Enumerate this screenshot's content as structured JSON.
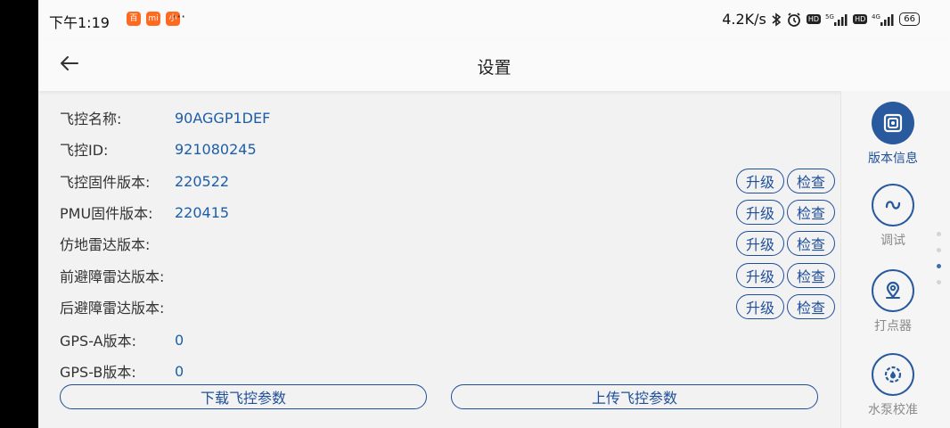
{
  "statusbar": {
    "time": "下午1:19",
    "app_icons": [
      "百",
      "mi",
      "小"
    ],
    "more": "···",
    "speed": "4.2K/s",
    "right_icons": [
      "bluetooth-icon",
      "alarm-icon",
      "hd-icon",
      "signal-5g-icon",
      "hd-icon",
      "signal-4g-icon"
    ],
    "battery": "66"
  },
  "header": {
    "title": "设置"
  },
  "fields": [
    {
      "label": "飞控名称:",
      "value": "90AGGP1DEF"
    },
    {
      "label": "飞控ID:",
      "value": "921080245"
    },
    {
      "label": "飞控固件版本:",
      "value": "220522"
    },
    {
      "label": "PMU固件版本:",
      "value": "220415"
    },
    {
      "label": "仿地雷达版本:",
      "value": ""
    },
    {
      "label": "前避障雷达版本:",
      "value": ""
    },
    {
      "label": "后避障雷达版本:",
      "value": ""
    },
    {
      "label": "GPS-A版本:",
      "value": "0"
    },
    {
      "label": "GPS-B版本:",
      "value": "0"
    }
  ],
  "buttons": {
    "upgrade": "升级",
    "check": "检查"
  },
  "actions": {
    "download": "下载飞控参数",
    "upload": "上传飞控参数"
  },
  "sidebar": {
    "items": [
      {
        "label": "版本信息",
        "icon": "version-info-icon",
        "active": true
      },
      {
        "label": "调试",
        "icon": "debug-icon",
        "active": false
      },
      {
        "label": "打点器",
        "icon": "location-pin-icon",
        "active": false
      },
      {
        "label": "水泵校准",
        "icon": "pump-calibration-icon",
        "active": false
      }
    ]
  },
  "colors": {
    "accent": "#1f4f9a",
    "value_text": "#1d5ea8",
    "muted": "#8a8a8a",
    "background": "#f2f2f2"
  }
}
